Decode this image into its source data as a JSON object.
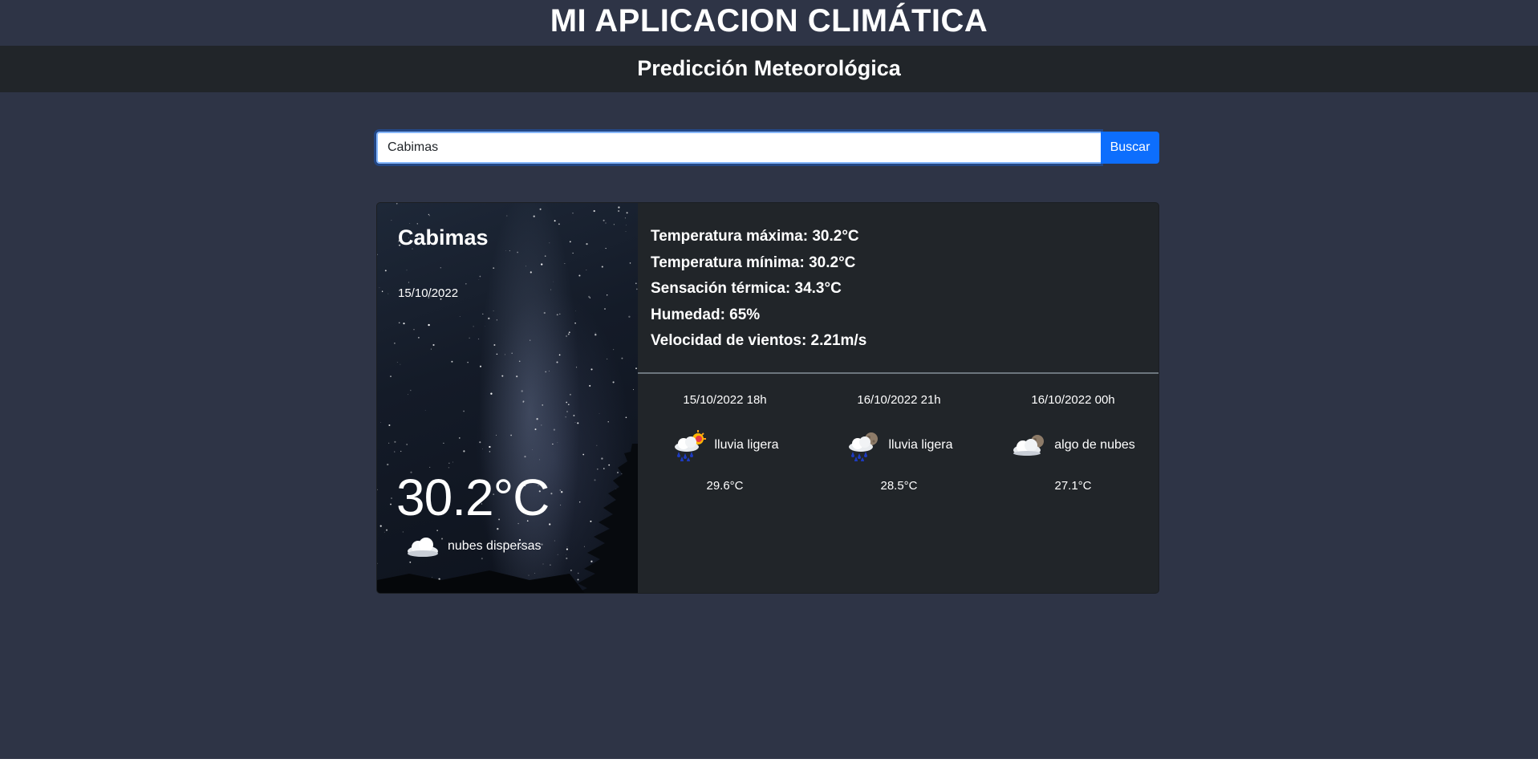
{
  "header": {
    "title": "MI APLICACION CLIMÁTICA",
    "subtitle": "Predicción Meteorológica"
  },
  "search": {
    "value": "Cabimas",
    "button_label": "Buscar"
  },
  "current": {
    "city": "Cabimas",
    "date": "15/10/2022",
    "temperature": "30.2°C",
    "condition": "nubes dispersas",
    "icon": "scattered-clouds-icon"
  },
  "stats": {
    "max": "Temperatura máxima: 30.2°C",
    "min": "Temperatura mínima: 30.2°C",
    "feels_like": "Sensación térmica: 34.3°C",
    "humidity": "Humedad: 65%",
    "wind": "Velocidad de vientos: 2.21m/s"
  },
  "forecast": [
    {
      "time": "15/10/2022 18h",
      "condition": "lluvia ligera",
      "temperature": "29.6°C",
      "icon": "light-rain-day-icon"
    },
    {
      "time": "16/10/2022 21h",
      "condition": "lluvia ligera",
      "temperature": "28.5°C",
      "icon": "light-rain-night-icon"
    },
    {
      "time": "16/10/2022 00h",
      "condition": "algo de nubes",
      "temperature": "27.1°C",
      "icon": "few-clouds-night-icon"
    }
  ],
  "colors": {
    "background": "#2e3446",
    "bar": "#212529",
    "accent": "#0d6efd"
  }
}
